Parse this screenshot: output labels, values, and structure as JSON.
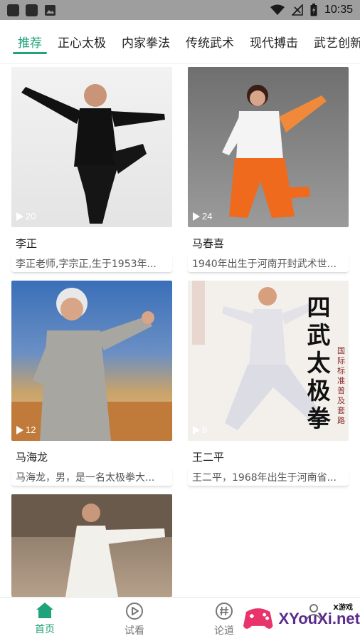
{
  "status_bar": {
    "time": "10:35",
    "icons": [
      "app-icon",
      "app-icon",
      "image-icon",
      "wifi-icon",
      "signal-icon",
      "battery-icon"
    ]
  },
  "tabs": [
    {
      "label": "推荐",
      "active": true
    },
    {
      "label": "正心太极",
      "active": false
    },
    {
      "label": "内家拳法",
      "active": false
    },
    {
      "label": "传统武术",
      "active": false
    },
    {
      "label": "现代搏击",
      "active": false
    },
    {
      "label": "武艺创新",
      "active": false
    }
  ],
  "cards": [
    {
      "name": "李正",
      "desc": "李正老师,字宗正,生于1953年...",
      "count": "20"
    },
    {
      "name": "马春喜",
      "desc": "1940年出生于河南开封武术世...",
      "count": "24"
    },
    {
      "name": "马海龙",
      "desc": "马海龙，男，是一名太极拳大...",
      "count": "12"
    },
    {
      "name": "王二平",
      "desc": "王二平，1968年出生于河南省...",
      "count": "8"
    },
    {
      "name": "",
      "desc": "",
      "count": ""
    }
  ],
  "poster_text": "四武太极拳",
  "poster_side_text": "国际标准普及套路",
  "bottom_nav": [
    {
      "label": "首页",
      "icon": "home-icon",
      "active": true
    },
    {
      "label": "试看",
      "icon": "play-circle-icon",
      "active": false
    },
    {
      "label": "论道",
      "icon": "hash-icon",
      "active": false
    },
    {
      "label": "",
      "icon": "profile-icon",
      "active": false
    }
  ],
  "watermark": {
    "text": "XYouXi.net",
    "small": "X游戏"
  },
  "colors": {
    "accent": "#1fa37a",
    "status_bar": "#9e9e9e"
  }
}
